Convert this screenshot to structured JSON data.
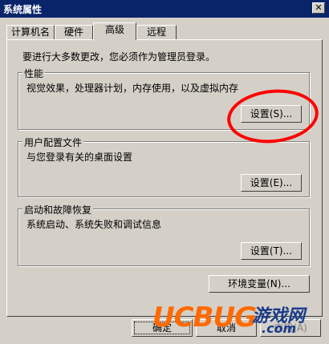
{
  "window": {
    "title": "系统属性",
    "close_glyph": "✕"
  },
  "tabs": [
    {
      "label": "计算机名"
    },
    {
      "label": "硬件"
    },
    {
      "label": "高级",
      "active": true
    },
    {
      "label": "远程"
    }
  ],
  "note": "要进行大多数更改，您必须作为管理员登录。",
  "performance": {
    "title": "性能",
    "description": "视觉效果，处理器计划，内存使用，以及虚拟内存",
    "button": "设置(S)..."
  },
  "user_profiles": {
    "title": "用户配置文件",
    "description": "与您登录有关的桌面设置",
    "button": "设置(E)..."
  },
  "startup_recovery": {
    "title": "启动和故障恢复",
    "description": "系统启动、系统失败和调试信息",
    "button": "设置(T)..."
  },
  "env_button": "环境变量(N)...",
  "footer": {
    "ok": "确定",
    "cancel": "取消",
    "apply": "应用(A)"
  },
  "watermark": {
    "logo": "UCBUG",
    "site": "游戏网",
    "domain": ".com"
  },
  "colors": {
    "titlebar": "#0a246a",
    "dialog": "#d4d0c8",
    "annotation": "#ff0000",
    "watermark_orange": "#ff6a00",
    "watermark_blue": "#1a3a8a"
  }
}
